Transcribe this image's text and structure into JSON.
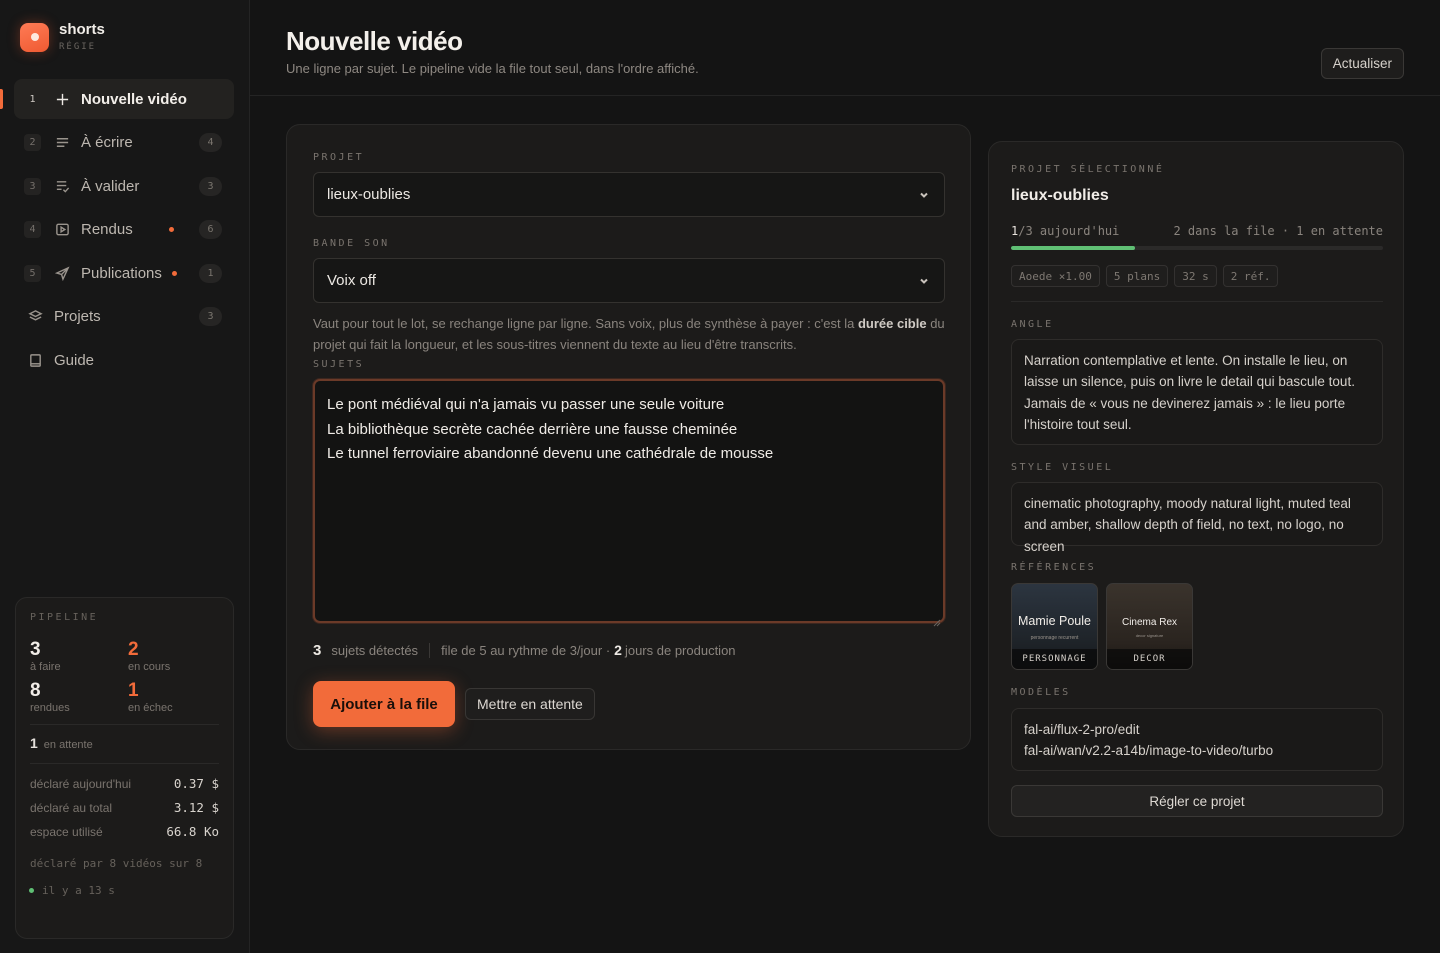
{
  "brand": {
    "name": "shorts",
    "subtitle": "RÉGIE"
  },
  "nav": {
    "items": [
      {
        "index": "1",
        "label": "Nouvelle vidéo",
        "icon": "plus-icon",
        "count": ""
      },
      {
        "index": "2",
        "label": "À écrire",
        "icon": "lines-icon",
        "count": "4"
      },
      {
        "index": "3",
        "label": "À valider",
        "icon": "list-check-icon",
        "count": "3"
      },
      {
        "index": "4",
        "label": "Rendus",
        "icon": "play-square-icon",
        "count": "6"
      },
      {
        "index": "5",
        "label": "Publications",
        "icon": "send-icon",
        "count": "1"
      },
      {
        "index": "",
        "label": "Projets",
        "icon": "layers-icon",
        "count": "3"
      },
      {
        "index": "",
        "label": "Guide",
        "icon": "book-icon",
        "count": ""
      }
    ]
  },
  "pipeline": {
    "title": "PIPELINE",
    "todo": {
      "value": "3",
      "label": "à faire"
    },
    "running": {
      "value": "2",
      "label": "en cours"
    },
    "rendered": {
      "value": "8",
      "label": "rendues"
    },
    "failed": {
      "value": "1",
      "label": "en échec"
    },
    "waiting": {
      "value": "1",
      "label": "en attente"
    },
    "stats": [
      {
        "label": "déclaré aujourd'hui",
        "value": "0.37 $"
      },
      {
        "label": "déclaré au total",
        "value": "3.12 $"
      },
      {
        "label": "espace utilisé",
        "value": "66.8 Ko"
      }
    ],
    "footer": "déclaré par 8 vidéos sur 8",
    "updated": "il y a 13 s"
  },
  "header": {
    "title": "Nouvelle vidéo",
    "subtitle": "Une ligne par sujet. Le pipeline vide la file tout seul, dans l'ordre affiché.",
    "refresh": "Actualiser"
  },
  "form": {
    "project_label": "PROJET",
    "project_value": "lieux-oublies",
    "sound_label": "BANDE SON",
    "sound_value": "Voix off",
    "help_before": "Vaut pour tout le lot, se rechange ligne par ligne. Sans voix, plus de synthèse à payer : c'est la ",
    "help_bold": "durée cible",
    "help_after": " du projet qui fait la longueur, et les sous-titres viennent du texte au lieu d'être transcrits.",
    "subjects_label": "SUJETS",
    "subjects": [
      "Le pont médiéval qui n'a jamais vu passer une seule voiture",
      "La bibliothèque secrète cachée derrière une fausse cheminée",
      "Le tunnel ferroviaire abandonné devenu une cathédrale de mousse"
    ],
    "detected_count": "3",
    "detected_label": "sujets détectés",
    "queue_before": "file de 5 au rythme de 3/jour · ",
    "queue_days": "2",
    "queue_after": "jours de production",
    "add_button": "Ajouter à la file",
    "hold_button": "Mettre en attente"
  },
  "project": {
    "label": "PROJET SÉLECTIONNÉ",
    "name": "lieux-oublies",
    "quota_done": "1",
    "quota_rest": "/3 aujourd'hui",
    "queue_info": "2 dans la file · 1 en attente",
    "quota_fraction": 0.333,
    "chips": [
      "Aoede ×1.00",
      "5 plans",
      "32 s",
      "2 réf."
    ],
    "angle_label": "ANGLE",
    "angle_text": "Narration contemplative et lente. On installe le lieu, on laisse un silence, puis on livre le detail qui bascule tout. Jamais de « vous ne devinerez jamais » : le lieu porte l'histoire tout seul.",
    "style_label": "STYLE VISUEL",
    "style_text": "cinematic photography, moody natural light, muted teal and amber, shallow depth of field, no text, no logo, no screen",
    "refs_label": "RÉFÉRENCES",
    "refs": [
      {
        "title": "Mamie Poule",
        "caption": "personnage recurrent",
        "tag": "PERSONNAGE"
      },
      {
        "title": "Cinema Rex",
        "caption": "decor signature",
        "tag": "DECOR"
      }
    ],
    "models_label": "MODÈLES",
    "models": [
      "fal-ai/flux-2-pro/edit",
      "fal-ai/wan/v2.2-a14b/image-to-video/turbo"
    ],
    "settings_button": "Régler ce projet"
  },
  "colors": {
    "accent": "#f26b3a",
    "success": "#5fbf74",
    "background": "#141414"
  }
}
